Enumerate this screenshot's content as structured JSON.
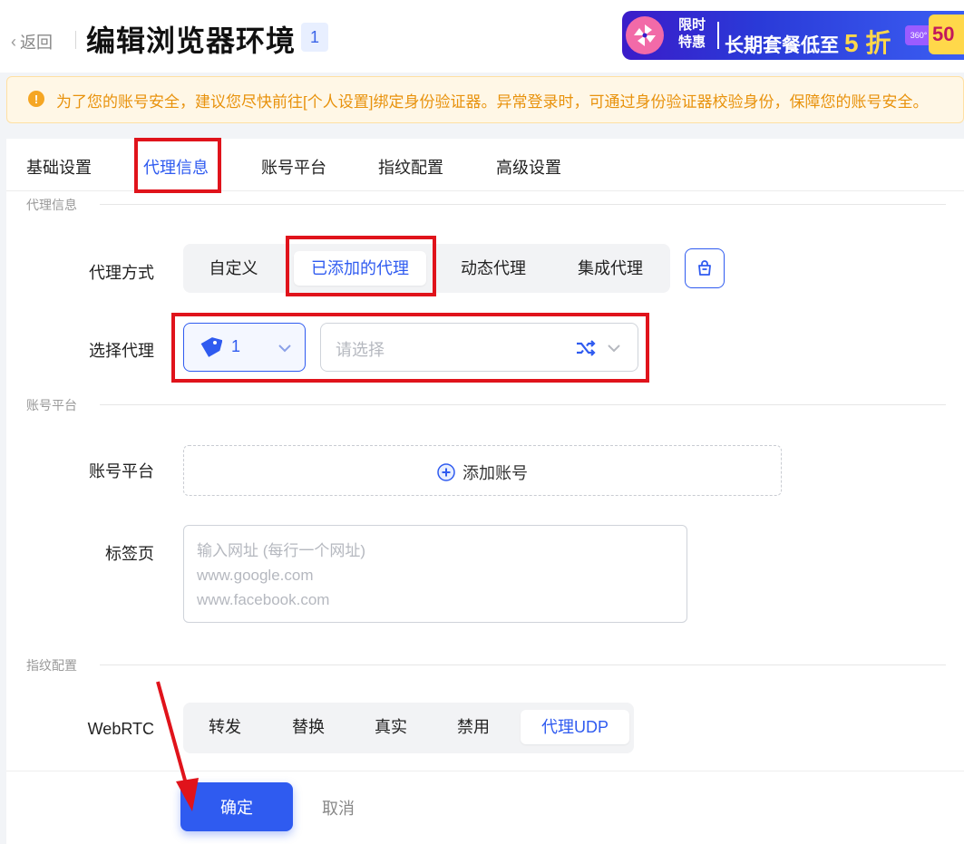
{
  "header": {
    "back_label": "返回",
    "title": "编辑浏览器环境",
    "badge": "1",
    "promo": {
      "limit_line1": "限时",
      "limit_line2": "特惠",
      "text": "长期套餐低至",
      "discount": "5 折",
      "tag": "360°",
      "corner": "50"
    }
  },
  "notice": {
    "icon": "!",
    "text": "为了您的账号安全，建议您尽快前往[个人设置]绑定身份验证器。异常登录时，可通过身份验证器校验身份，保障您的账号安全。"
  },
  "tabs": [
    {
      "label": "基础设置"
    },
    {
      "label": "代理信息"
    },
    {
      "label": "账号平台"
    },
    {
      "label": "指纹配置"
    },
    {
      "label": "高级设置"
    }
  ],
  "active_tab": "代理信息",
  "proxy_section": {
    "heading": "代理信息",
    "method_label": "代理方式",
    "methods": [
      "自定义",
      "已添加的代理",
      "动态代理",
      "集成代理"
    ],
    "active_method": "已添加的代理",
    "select_label": "选择代理",
    "selected_proxy": "1",
    "second_placeholder": "请选择"
  },
  "account_section": {
    "heading": "账号平台",
    "platform_label": "账号平台",
    "add_account": "添加账号",
    "tabs_label": "标签页",
    "tabs_placeholder": "输入网址 (每行一个网址)\nwww.google.com\nwww.facebook.com"
  },
  "fingerprint_section": {
    "heading": "指纹配置",
    "webrtc_label": "WebRTC",
    "webrtc_options": [
      "转发",
      "替换",
      "真实",
      "禁用",
      "代理UDP"
    ],
    "active_webrtc": "代理UDP"
  },
  "footer": {
    "confirm": "确定",
    "cancel": "取消"
  },
  "colors": {
    "accent": "#2f5bf0",
    "highlight_box": "#e0131b",
    "notice_text": "#e8920c"
  }
}
